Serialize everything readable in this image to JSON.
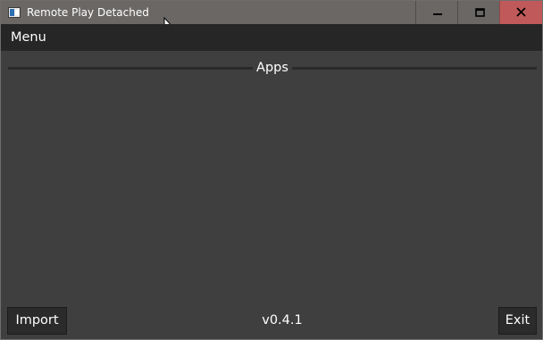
{
  "window": {
    "title": "Remote Play Detached",
    "controls": {
      "minimize_icon": "minimize-icon",
      "maximize_icon": "maximize-icon",
      "close_icon": "close-icon"
    }
  },
  "menubar": {
    "items": [
      {
        "label": "Menu"
      }
    ]
  },
  "apps_section": {
    "title": "Apps",
    "items": []
  },
  "footer": {
    "import_label": "Import",
    "version": "v0.4.1",
    "exit_label": "Exit"
  },
  "colors": {
    "titlebar": "#6a6765",
    "close_button": "#c05a5a",
    "menubar": "#262626",
    "background": "#3f3f3f",
    "button": "#2b2b2b",
    "text": "#ffffff"
  }
}
